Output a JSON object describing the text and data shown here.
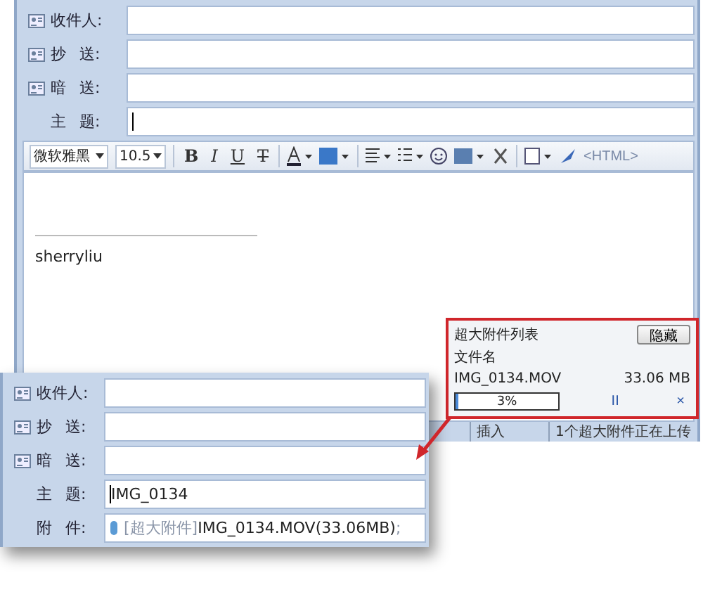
{
  "compose": {
    "fields": [
      {
        "label": "收件人:",
        "kind": "contact"
      },
      {
        "label": "抄 送:",
        "kind": "contact"
      },
      {
        "label": "暗 送:",
        "kind": "contact"
      },
      {
        "label": "主 题:",
        "kind": "subject"
      }
    ],
    "toolbar": {
      "font": "微软雅黑",
      "size": "10.5",
      "format_buttons": [
        "B",
        "I",
        "U",
        "T"
      ],
      "html_button": "<HTML>"
    },
    "editor": {
      "signature": "sherryliu"
    },
    "status_bar": [
      "插入",
      "1个超大附件正在上传"
    ]
  },
  "upload_panel": {
    "title": "超大附件列表",
    "hide_button": "隐藏",
    "column": "文件名",
    "file": {
      "name": "IMG_0134.MOV",
      "size": "33.06 MB",
      "level": 0.03,
      "progress": "3%",
      "pause": "II",
      "cancel": "×"
    }
  },
  "inset": {
    "fields": [
      {
        "label": "收件人:",
        "kind": "contact"
      },
      {
        "label": "抄 送:",
        "kind": "contact"
      },
      {
        "label": "暗 送:",
        "kind": "contact"
      },
      {
        "label": "主 题:",
        "kind": "subject",
        "value": "IMG_0134"
      },
      {
        "label": "附 件:",
        "kind": "attachment",
        "tag": "[超大附件]",
        "file": "IMG_0134.MOV(33.06MB)",
        "separator": ";"
      }
    ]
  }
}
